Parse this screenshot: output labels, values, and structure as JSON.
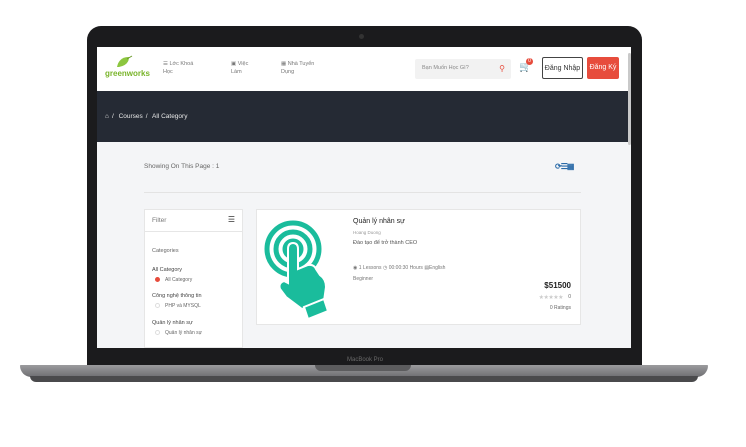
{
  "device": {
    "label": "MacBook Pro"
  },
  "header": {
    "logo_text": "greenworks",
    "nav": [
      {
        "icon": "list-icon",
        "label": "Lớc Khoá Học"
      },
      {
        "icon": "briefcase-icon",
        "label": "Việc Làm"
      },
      {
        "icon": "building-icon",
        "label": "Nhà Tuyển Dụng"
      }
    ],
    "search_placeholder": "Bạn Muốn Học Gì?",
    "cart_count": "0",
    "login_label": "Đăng Nhập",
    "register_label": "Đăng Ký"
  },
  "breadcrumb": {
    "home_icon": "home-icon",
    "items": [
      "Courses",
      "All Category"
    ]
  },
  "listing": {
    "showing_text": "Showing On This Page : 1"
  },
  "filter": {
    "title": "Filter",
    "categories_label": "Categories",
    "groups": [
      {
        "name": "All Category",
        "options": [
          {
            "label": "All Category",
            "selected": true
          }
        ]
      },
      {
        "name": "Công nghệ thông tin",
        "options": [
          {
            "label": "PHP và MYSQL",
            "selected": false
          }
        ]
      },
      {
        "name": "Quản lý nhân sự",
        "options": [
          {
            "label": "Quản lý nhân sự",
            "selected": false
          }
        ]
      }
    ]
  },
  "course": {
    "title": "Quản lý nhân sự",
    "author": "Hoang Duong",
    "description": "Đào tạo để trở thành CEO",
    "lessons": "1 Lessons",
    "duration": "00:00:30 Hours",
    "language": "English",
    "level": "Beginner",
    "price": "$51500",
    "rating_value": "0",
    "ratings_count": "0 Ratings",
    "stars": 0
  },
  "colors": {
    "accent": "#e74c3c",
    "dark_bar": "#252a34",
    "brand_green": "#79b42a",
    "thumb_teal": "#1abc9c"
  }
}
